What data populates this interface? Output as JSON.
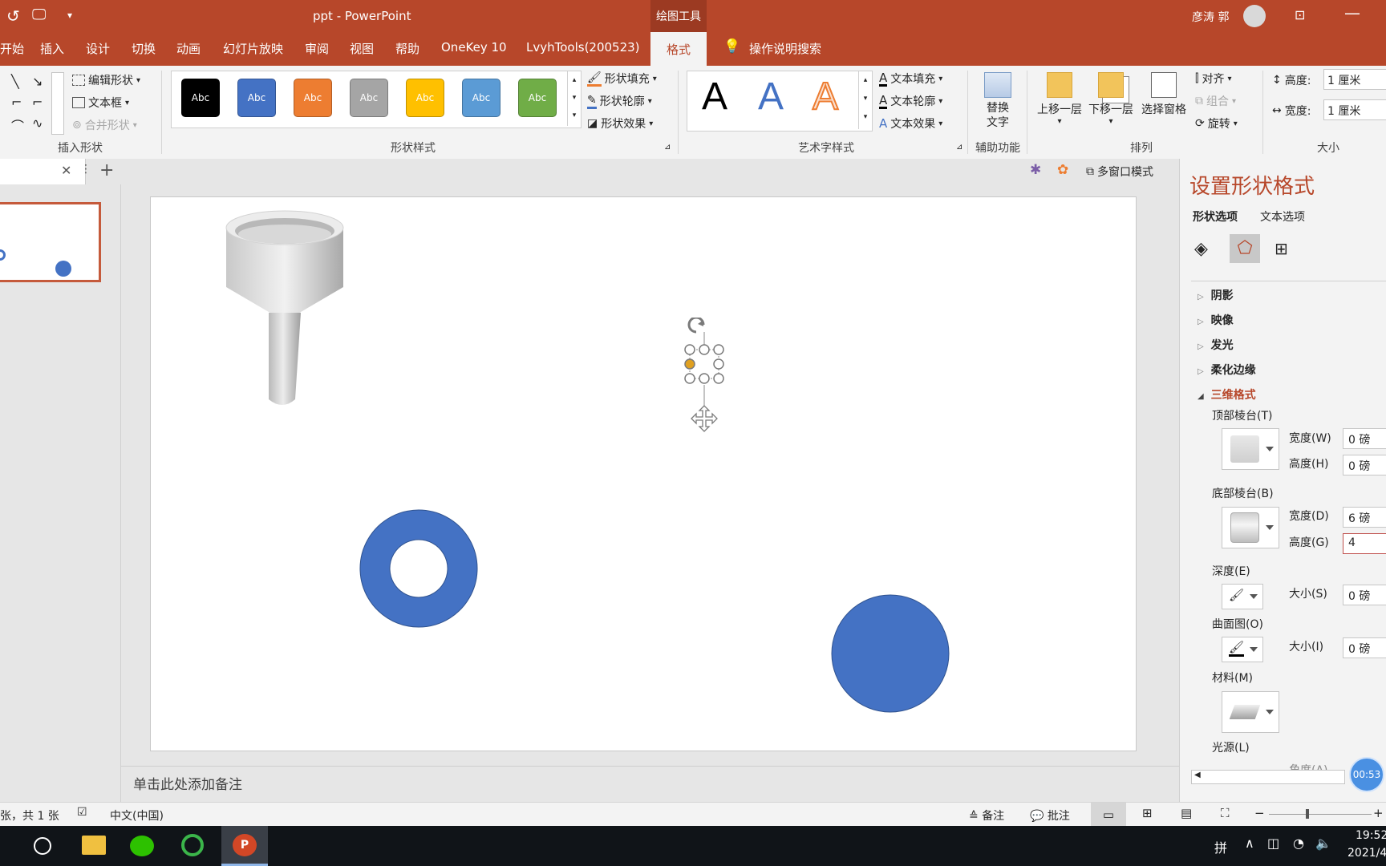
{
  "window": {
    "title": "ppt  -  PowerPoint",
    "context_tab_group": "绘图工具",
    "user": "彦涛 郭"
  },
  "menu": {
    "tabs": [
      "开始",
      "插入",
      "设计",
      "切换",
      "动画",
      "幻灯片放映",
      "审阅",
      "视图",
      "帮助",
      "OneKey 10",
      "LvyhTools(200523)"
    ],
    "active_tab": "格式",
    "search": "操作说明搜索"
  },
  "ribbon": {
    "insert_shapes": {
      "label": "插入形状",
      "edit_shape": "编辑形状",
      "textbox": "文本框",
      "merge_shapes": "合并形状"
    },
    "shape_styles": {
      "label": "形状样式",
      "preset_text": "Abc",
      "presets": [
        "#000000",
        "#4472c4",
        "#ed7d31",
        "#a5a5a5",
        "#ffc000",
        "#5b9bd5",
        "#70ad47"
      ],
      "fill": "形状填充",
      "outline": "形状轮廓",
      "effects": "形状效果"
    },
    "wordart": {
      "label": "艺术字样式",
      "sample": "A",
      "fill": "文本填充",
      "outline": "文本轮廓",
      "effects": "文本效果"
    },
    "accessibility": {
      "label": "辅助功能",
      "alt_text": "替换文字"
    },
    "arrange": {
      "label": "排列",
      "bring_forward": "上移一层",
      "send_backward": "下移一层",
      "selection_pane": "选择窗格",
      "align": "对齐",
      "group": "组合",
      "rotate": "旋转"
    },
    "size": {
      "label": "大小",
      "height_label": "高度:",
      "height": "1 厘米",
      "width_label": "宽度:",
      "width": "1 厘米"
    }
  },
  "tabrow": {
    "multiwindow": "多窗口模式"
  },
  "notes": {
    "placeholder": "单击此处添加备注"
  },
  "format_pane": {
    "title": "设置形状格式",
    "tabs": [
      "形状选项",
      "文本选项"
    ],
    "sections": {
      "shadow": "阴影",
      "reflection": "映像",
      "glow": "发光",
      "soft_edges": "柔化边缘",
      "format_3d": "三维格式"
    },
    "top_bevel": "顶部棱台(T)",
    "top_width_label": "宽度(W)",
    "top_width": "0 磅",
    "top_height_label": "高度(H)",
    "top_height": "0 磅",
    "bottom_bevel": "底部棱台(B)",
    "bottom_width_label": "宽度(D)",
    "bottom_width": "6 磅",
    "bottom_height_label": "高度(G)",
    "bottom_height": "4",
    "depth": "深度(E)",
    "depth_size_label": "大小(S)",
    "depth_size": "0 磅",
    "contour": "曲面图(O)",
    "contour_size_label": "大小(I)",
    "contour_size": "0 磅",
    "material": "材料(M)",
    "lighting": "光源(L)",
    "angle": "角度(A)"
  },
  "status": {
    "slide_count": "张，共 1 张",
    "language": "中文(中国)",
    "notes": "备注",
    "comments": "批注",
    "timer": "00:53"
  },
  "taskbar": {
    "ime": "拼",
    "time": "19:52",
    "date": "2021/4"
  },
  "colors": {
    "accent": "#b7472a",
    "shape_blue": "#4472c4"
  }
}
